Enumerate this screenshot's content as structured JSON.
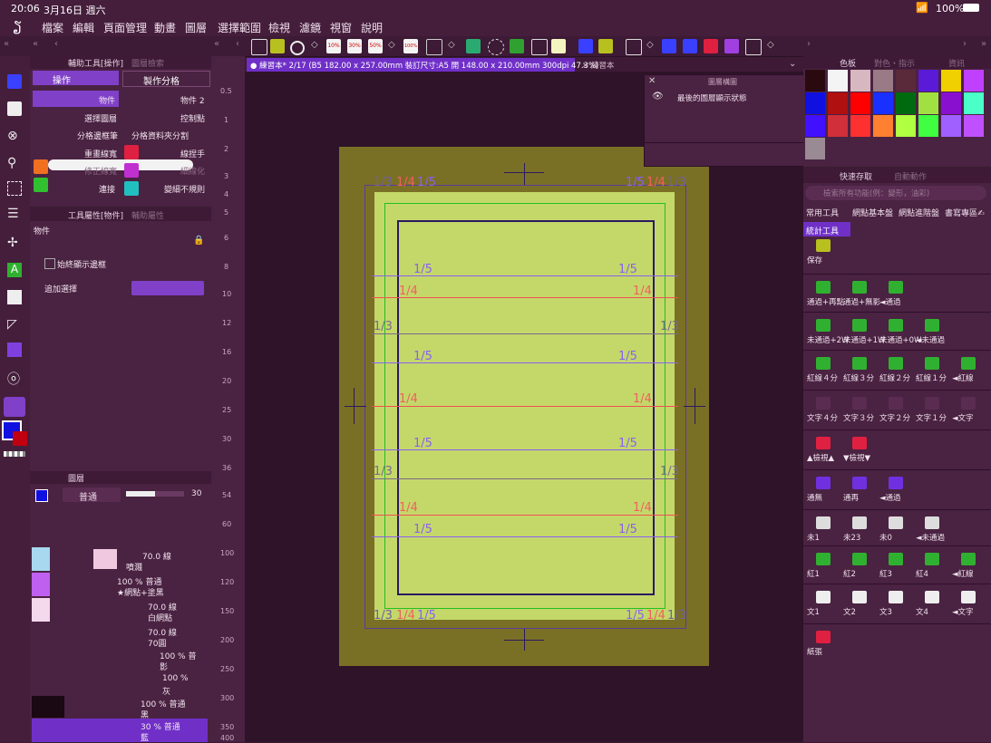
{
  "status": {
    "time": "20:06",
    "date": "3月16日 週六",
    "battery": "100%"
  },
  "menu": [
    "檔案",
    "編輯",
    "頁面管理",
    "動畫",
    "圖層",
    "選擇範圍",
    "檢視",
    "濾鏡",
    "視窗",
    "說明"
  ],
  "toolbar": {
    "pct10": "10%",
    "pct30": "30%",
    "pct50": "50%",
    "pct100": "100%"
  },
  "subtool_panel": {
    "tab_active": "輔助工具[操作]",
    "tab_inactive": "圖層檢索",
    "group_left": "操作",
    "group_right": "製作分格",
    "items": [
      {
        "left": "物件",
        "right": "物件 2"
      },
      {
        "left": "選擇圖層",
        "right": "控制點"
      },
      {
        "left": "分格邊框筆",
        "right": "分格資料夾分割"
      },
      {
        "left": "重畫線寬",
        "right": "線捏手"
      },
      {
        "left": "修正線寬",
        "right": "細線化"
      },
      {
        "left": "連接",
        "right": "變細不規則"
      }
    ]
  },
  "tool_property": {
    "tab_active": "工具屬性[物件]",
    "tab_inactive": "輔助屬性",
    "title": "物件",
    "always_show": "始終顯示邊框",
    "add_select": "追加選擇"
  },
  "layer_panel": {
    "title": "圖層",
    "blend": "普通",
    "opacity": "30",
    "layers": [
      {
        "line1": "70.0 線",
        "line2": "噴濺"
      },
      {
        "line1": "100 % 普通",
        "line2": "★網點+塗黑"
      },
      {
        "line1": "70.0 線",
        "line2": "白網點"
      },
      {
        "line1": "70.0 線",
        "line2": "70圓"
      },
      {
        "line1": "100 % 普",
        "line2": "影"
      },
      {
        "line1": "100 %",
        "line2": "灰"
      },
      {
        "line1": "100 % 普通",
        "line2": "黑"
      },
      {
        "line1": "30 % 普通",
        "line2": "藍"
      }
    ]
  },
  "ruler": {
    "marks": [
      "0.5",
      "1",
      "2",
      "3",
      "4",
      "5",
      "6",
      "8",
      "10",
      "12",
      "16",
      "20",
      "25",
      "30",
      "36",
      "54",
      "60",
      "100",
      "120",
      "150",
      "200",
      "250",
      "300",
      "350",
      "400"
    ]
  },
  "canvas_tabs": {
    "active": "● 練習本* 2/17 (B5 182.00 x 257.00mm 裝訂尺寸:A5 開 148.00 x 210.00mm 300dpi 47.3%)",
    "inactive": "✕ 練習本"
  },
  "layer_search": {
    "title": "圖層構圖",
    "item": "最後的圖層顯示狀態"
  },
  "guide_labels": {
    "third": "1/3",
    "quarter": "1/4",
    "fifth": "1/5"
  },
  "color_panel": {
    "tab_active": "色板",
    "tab2": "對色・指示",
    "tab3": "資訊",
    "swatches": [
      "#2a0a0f",
      "#f4f4f4",
      "#d8b8c0",
      "#9a7a84",
      "#5a2a3a",
      "#5a1ad8",
      "#f0d000",
      "#c040ff",
      "#1010e0",
      "#b01010",
      "#ff0000",
      "#1a30ff",
      "#006a10",
      "#a0e040",
      "#8a10d0",
      "#4affc8",
      "#4010ff",
      "#d0303a",
      "#ff3030",
      "#ff8030",
      "#b0ff40",
      "#40ff40",
      "#a060ff",
      "#c050ff",
      "#9a8a94"
    ]
  },
  "quick_access": {
    "tab_active": "快速存取",
    "tab2": "自動動作",
    "search_placeholder": "檢索所有功能(例：變形，油彩)",
    "tabs": [
      "常用工具",
      "網點基本盤",
      "網點進階盤",
      "書寫專區✍"
    ],
    "sub_tab": "統計工具",
    "rows": [
      [
        "保存"
      ],
      [
        "通過+再點",
        "通過+無影",
        "◄通過"
      ],
      [
        "未通過+2W",
        "未通過+1W",
        "未通過+0W",
        "◄未通過"
      ],
      [
        "紅線４分",
        "紅線３分",
        "紅線２分",
        "紅線１分",
        "◄紅線"
      ],
      [
        "文字４分",
        "文字３分",
        "文字２分",
        "文字１分",
        "◄文字"
      ],
      [
        "▲檢視▲",
        "▼檢視▼"
      ],
      [
        "通無",
        "通再",
        "◄通過"
      ],
      [
        "未1",
        "未23",
        "未0",
        "◄未通過"
      ],
      [
        "紅1",
        "紅2",
        "紅3",
        "紅4",
        "◄紅線"
      ],
      [
        "文1",
        "文2",
        "文3",
        "文4",
        "◄文字"
      ],
      [
        "紙張"
      ]
    ]
  }
}
